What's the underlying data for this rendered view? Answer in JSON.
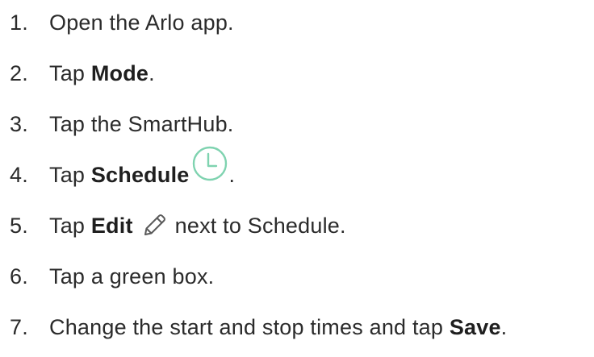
{
  "steps": [
    {
      "number": "1.",
      "text": "Open the Arlo app."
    },
    {
      "number": "2.",
      "prefix": "Tap ",
      "bold": "Mode",
      "suffix": "."
    },
    {
      "number": "3.",
      "text": "Tap the SmartHub."
    },
    {
      "number": "4.",
      "prefix": "Tap ",
      "bold": "Schedule",
      "icon": "clock-icon",
      "suffix": "."
    },
    {
      "number": "5.",
      "prefix": "Tap ",
      "bold": "Edit",
      "icon": "pencil-icon",
      "suffix": "next to Schedule."
    },
    {
      "number": "6.",
      "text": "Tap a green box."
    },
    {
      "number": "7.",
      "prefix": "Change the start and stop times and tap ",
      "bold": "Save",
      "suffix": "."
    }
  ],
  "colors": {
    "text": "#2b2b2b",
    "clock_icon": "#7fd3b0",
    "pencil_icon": "#5a5a5a"
  }
}
